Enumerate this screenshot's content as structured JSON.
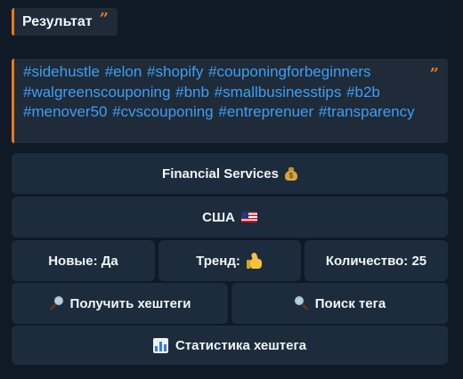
{
  "header": {
    "title": "Результат"
  },
  "hashtags": {
    "text": "#sidehustle #elon #shopify #couponingforbeginners #walgreenscouponing #bnb #smallbusinesstips #b2b #menover50 #cvscouponing #entreprenuer #transparency"
  },
  "buttons": {
    "category": "Financial Services",
    "country": "США",
    "new": "Новые: Да",
    "trend": "Тренд:",
    "count": "Количество: 25",
    "get_hashtags": "Получить хештеги",
    "search_tag": "Поиск тега",
    "statistics": "Статистика хештега"
  },
  "icons": {
    "quote": "quote-icon",
    "money_bag": "money-bag-icon",
    "us_flag": "us-flag-icon",
    "thumbs_up": "thumbs-up-icon",
    "magnifier_right": "magnifier-right-icon",
    "magnifier_left": "magnifier-left-icon",
    "bar_chart": "bar-chart-icon"
  },
  "colors": {
    "background": "#0f1a26",
    "accent": "#e8781f",
    "hashtag": "#3d9ff5",
    "button": "#1d2c3c"
  }
}
